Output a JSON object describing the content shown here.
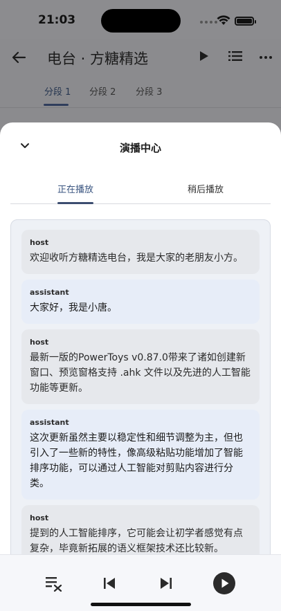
{
  "status": {
    "time": "21:03"
  },
  "header": {
    "title": "电台 · 方糖精选",
    "tabs": [
      {
        "label": "分段 1",
        "active": true
      },
      {
        "label": "分段 2",
        "active": false
      },
      {
        "label": "分段 3",
        "active": false
      }
    ]
  },
  "sheet": {
    "title": "演播中心",
    "tabs": [
      {
        "label": "正在播放",
        "active": true
      },
      {
        "label": "稍后播放",
        "active": false
      }
    ],
    "messages": [
      {
        "role": "host",
        "text": "欢迎收听方糖精选电台，我是大家的老朋友小方。"
      },
      {
        "role": "assistant",
        "text": "大家好，我是小唐。"
      },
      {
        "role": "host",
        "text": "最新一版的PowerToys v0.87.0带来了诸如创建新窗口、预览窗格支持 .ahk 文件以及先进的人工智能功能等更新。"
      },
      {
        "role": "assistant",
        "text": "这次更新虽然主要以稳定性和细节调整为主，但也引入了一些新的特性，像高级粘贴功能增加了智能排序功能，可以通过人工智能对剪贴内容进行分类。"
      },
      {
        "role": "host",
        "text": "提到的人工智能排序，它可能会让初学者感觉有点复杂，毕竟新拓展的语义框架技术还比较新。"
      }
    ]
  },
  "icons": {
    "back": "arrow-left-icon",
    "play": "play-icon",
    "list": "list-icon",
    "more": "more-horizontal-icon",
    "collapse": "chevron-down-icon",
    "clear_queue": "clear-queue-icon",
    "previous": "skip-previous-icon",
    "next": "skip-next-icon",
    "play_circle": "play-circle-icon"
  }
}
